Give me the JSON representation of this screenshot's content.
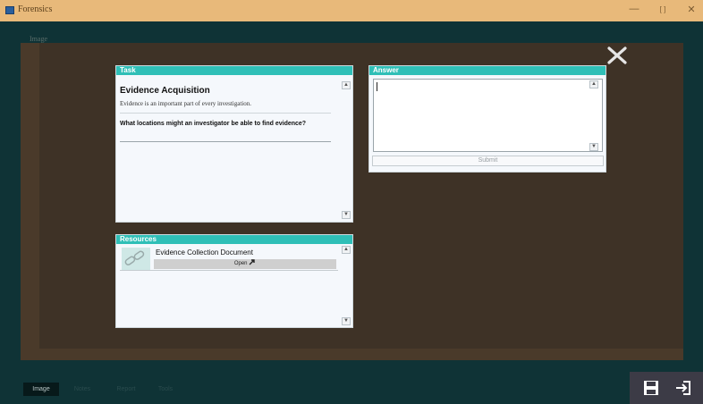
{
  "window": {
    "title": "Forensics",
    "restore_label": "[ ]"
  },
  "workspace": {
    "label": "Image"
  },
  "task": {
    "header": "Task",
    "title": "Evidence Acquisition",
    "description": "Evidence is an important part of every investigation.",
    "question": "What locations might an investigator be able to find evidence?"
  },
  "answer": {
    "header": "Answer",
    "value": "",
    "submit_label": "Submit"
  },
  "resources": {
    "header": "Resources",
    "items": [
      {
        "name": "Evidence Collection Document",
        "open_label": "Open"
      }
    ]
  },
  "bottom": {
    "tabs": [
      {
        "label": "Image",
        "active": true
      },
      {
        "label": "Notes",
        "active": false
      },
      {
        "label": "Report",
        "active": false
      },
      {
        "label": "Tools",
        "active": false
      }
    ]
  },
  "colors": {
    "accent": "#2fbfb7",
    "titlebar": "#e8b97a",
    "frame": "#4a3a2a"
  },
  "icons": [
    "minimize-icon",
    "maximize-icon",
    "close-icon",
    "dismiss-icon",
    "link-icon",
    "external-link-icon",
    "save-icon",
    "exit-icon"
  ]
}
